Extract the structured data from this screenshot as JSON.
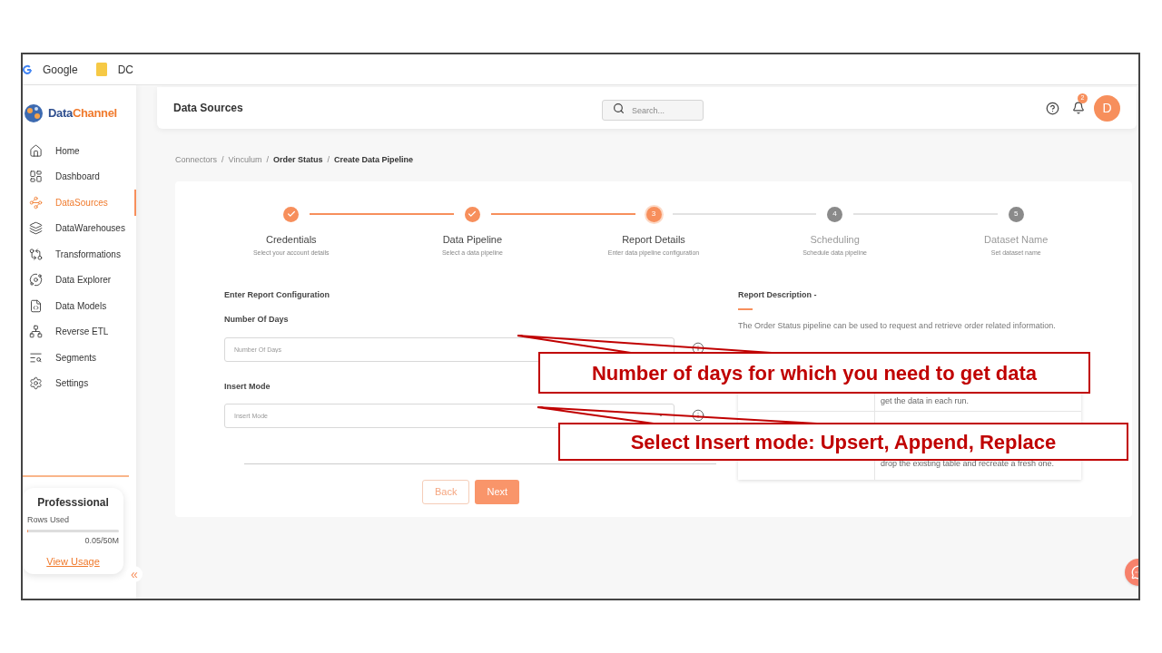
{
  "bookmarks": [
    {
      "label": "Google",
      "kind": "google"
    },
    {
      "label": "DC",
      "kind": "folder"
    }
  ],
  "brand": {
    "first": "Data",
    "second": "Channel"
  },
  "sidebar": {
    "items": [
      {
        "label": "Home",
        "selected": false
      },
      {
        "label": "Dashboard",
        "selected": false
      },
      {
        "label": "DataSources",
        "selected": true
      },
      {
        "label": "DataWarehouses",
        "selected": false
      },
      {
        "label": "Transformations",
        "selected": false
      },
      {
        "label": "Data Explorer",
        "selected": false
      },
      {
        "label": "Data Models",
        "selected": false
      },
      {
        "label": "Reverse ETL",
        "selected": false
      },
      {
        "label": "Segments",
        "selected": false
      },
      {
        "label": "Settings",
        "selected": false
      }
    ],
    "plan": {
      "name": "Professsional",
      "usage_label": "Rows Used",
      "level": 0.001,
      "usage": "0.05/50M",
      "link": "View Usage"
    },
    "collapse": "«"
  },
  "header": {
    "title": "Data Sources",
    "search_placeholder": "Search...",
    "notifications": "2",
    "avatar": "D"
  },
  "breadcrumb": {
    "separator": "/",
    "items": [
      {
        "label": "Connectors",
        "bold": false
      },
      {
        "label": "Vinculum",
        "bold": false
      },
      {
        "label": "Order Status",
        "bold": true
      },
      {
        "label": "Create Data Pipeline",
        "bold": true
      }
    ]
  },
  "steps": [
    {
      "title": "Credentials",
      "subtitle": "Select your account details",
      "done": true,
      "selected": false
    },
    {
      "title": "Data Pipeline",
      "subtitle": "Select a data pipeline",
      "done": true,
      "selected": false
    },
    {
      "marker": "3",
      "title": "Report Details",
      "subtitle": "Enter data pipeline configuration",
      "done": false,
      "selected": true
    },
    {
      "marker": "4",
      "title": "Scheduling",
      "subtitle": "Schedule data pipeline",
      "done": false,
      "selected": false
    },
    {
      "marker": "5",
      "title": "Dataset Name",
      "subtitle": "Set dataset name",
      "done": false,
      "selected": false
    }
  ],
  "form": {
    "heading": "Enter Report Configuration",
    "fields": [
      {
        "label": "Number Of Days",
        "placeholder": "Number Of Days",
        "kind": "text"
      },
      {
        "label": "Insert Mode",
        "placeholder": "Insert Mode",
        "kind": "select"
      }
    ],
    "buttons": [
      {
        "label": "Back",
        "kind": "secondary"
      },
      {
        "label": "Next",
        "kind": "primary"
      }
    ]
  },
  "description": {
    "title": "Report Description -",
    "text": "The Order Status pipeline can be used to request and retrieve order related information.",
    "rows": [
      {
        "detail": "get the data in each run."
      },
      {
        "detail": "drop the existing table and recreate a fresh one."
      }
    ]
  },
  "callouts": [
    "Number of days for which you need to get data",
    "Select Insert mode: Upsert, Append, Replace"
  ]
}
